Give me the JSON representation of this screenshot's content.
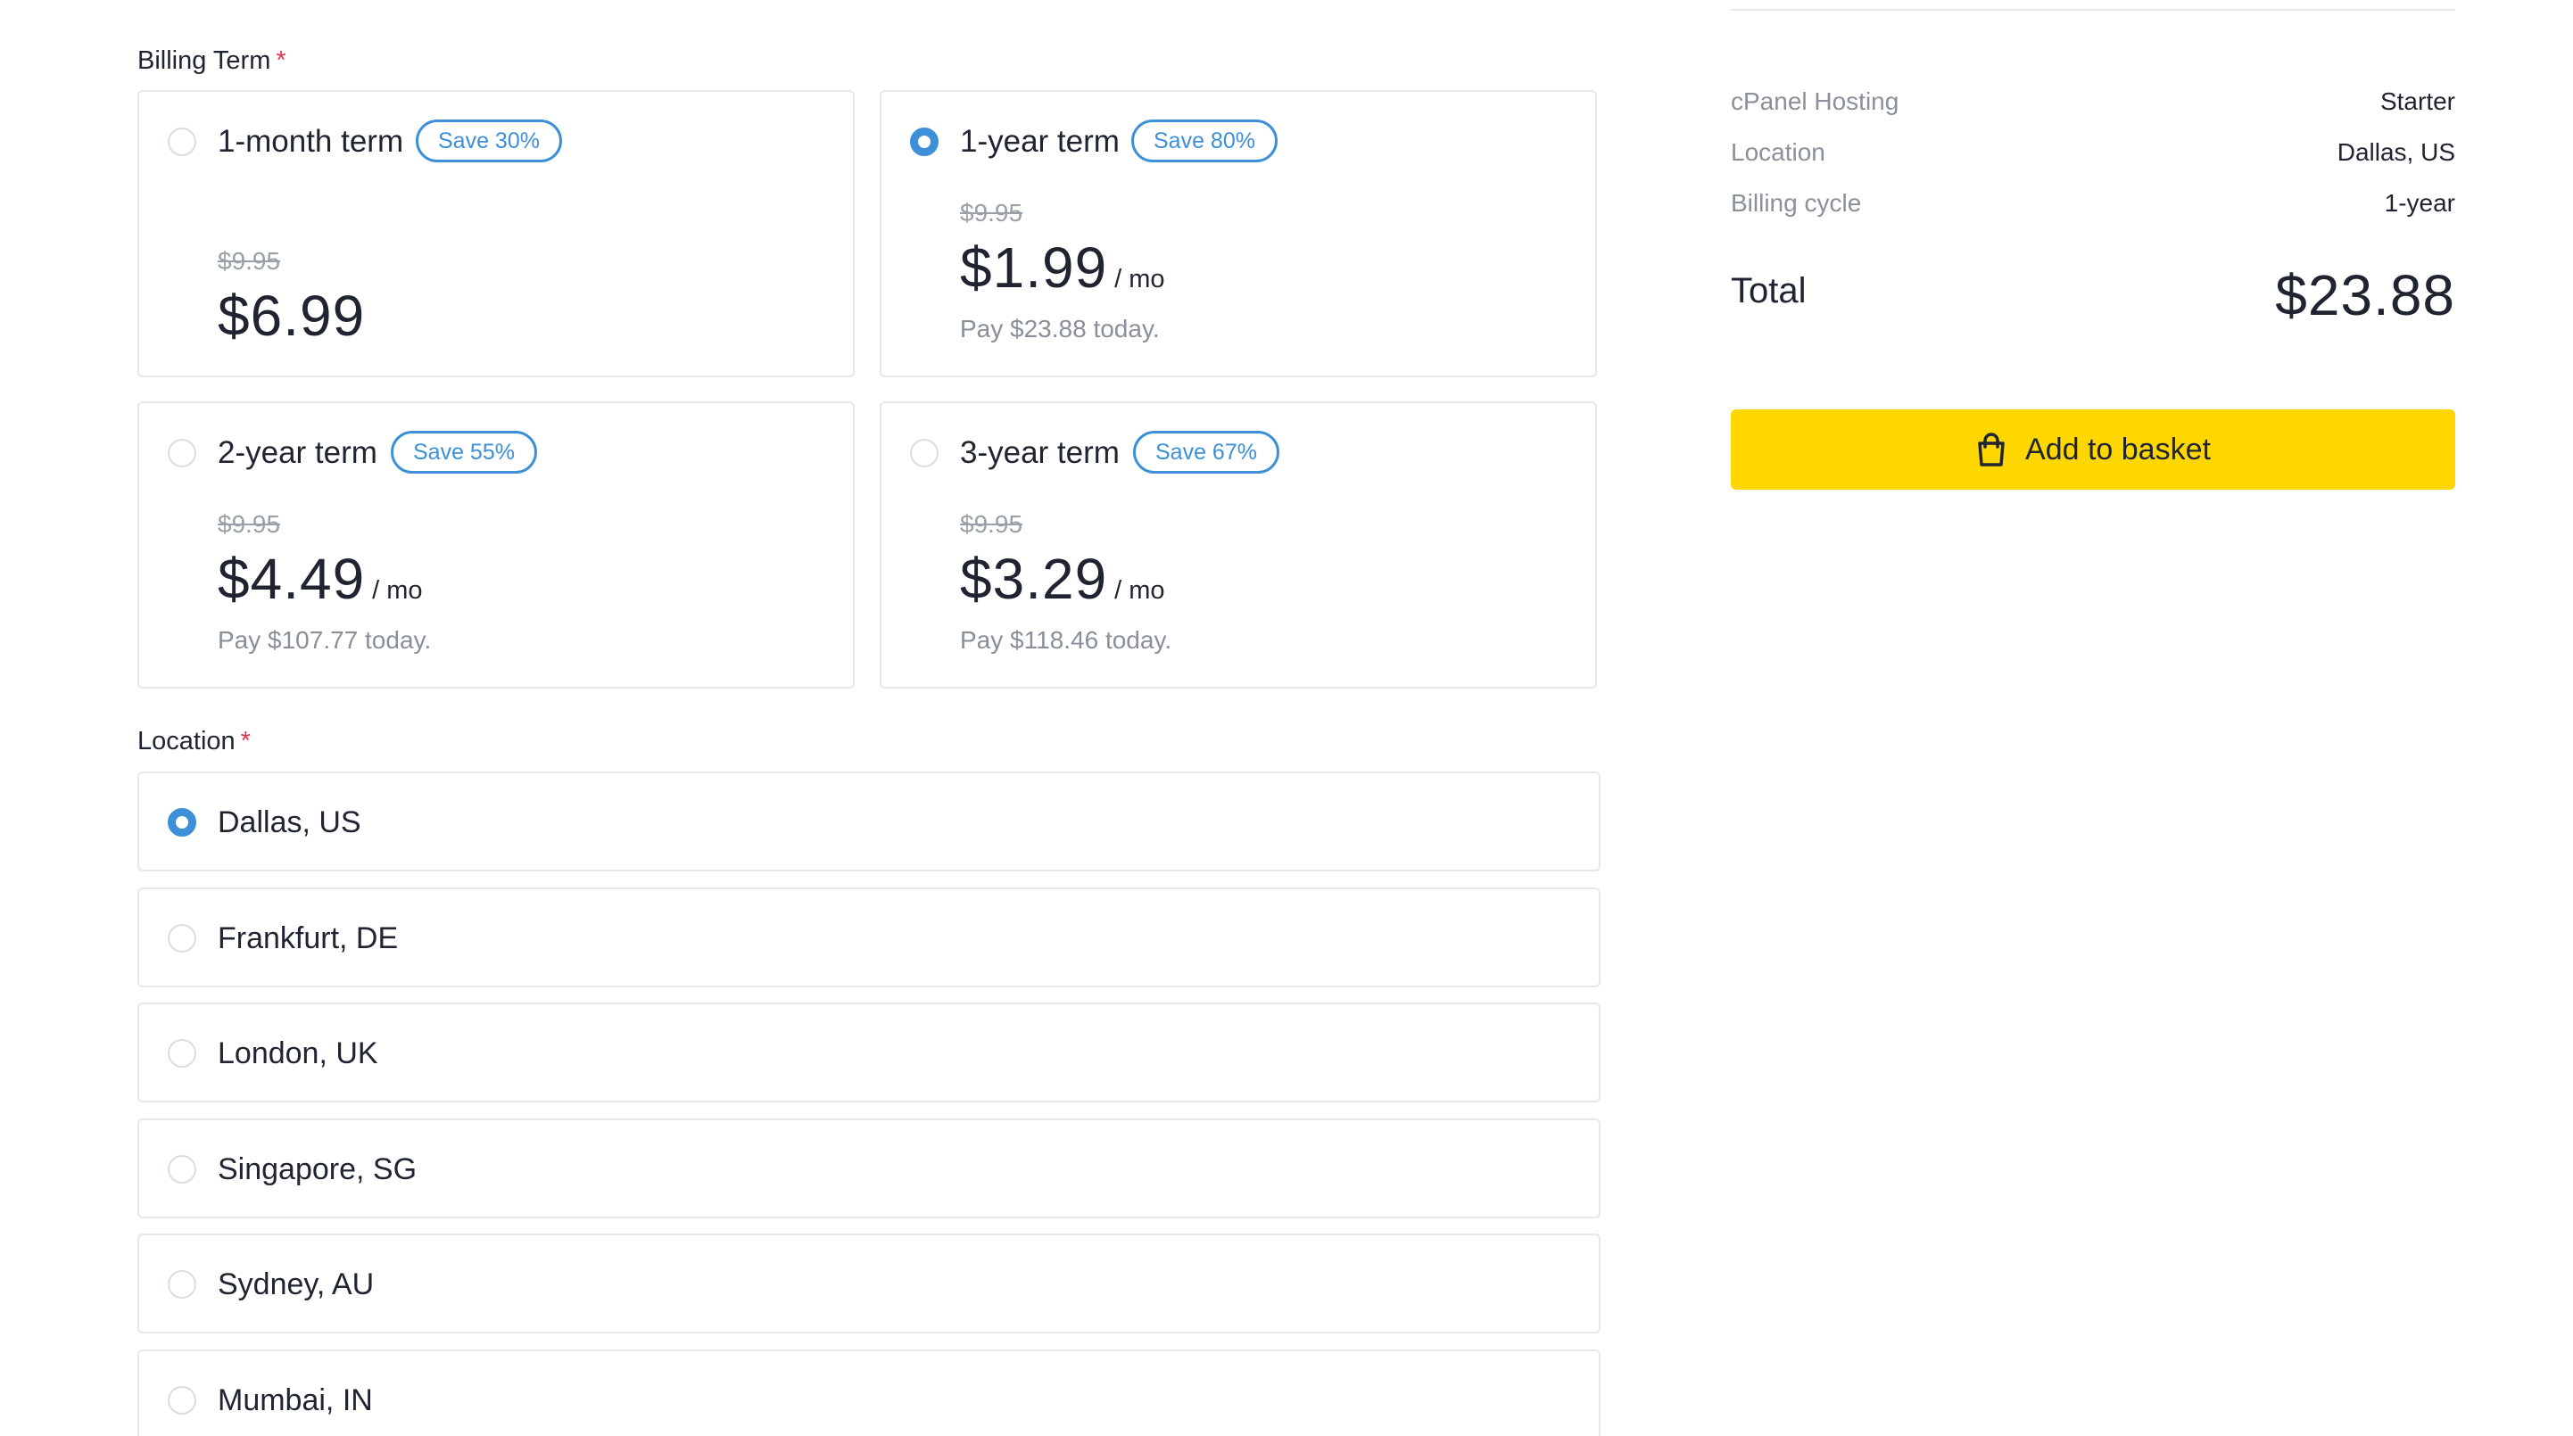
{
  "billing_term": {
    "label": "Billing Term",
    "required_mark": "*",
    "options": [
      {
        "name": "1-month term",
        "badge": "Save 30%",
        "old_price": "$9.95",
        "price": "$6.99",
        "per": "",
        "pay_today": "",
        "selected": false
      },
      {
        "name": "1-year term",
        "badge": "Save 80%",
        "old_price": "$9.95",
        "price": "$1.99",
        "per": "/ mo",
        "pay_today": "Pay $23.88 today.",
        "selected": true
      },
      {
        "name": "2-year term",
        "badge": "Save 55%",
        "old_price": "$9.95",
        "price": "$4.49",
        "per": "/ mo",
        "pay_today": "Pay $107.77 today.",
        "selected": false
      },
      {
        "name": "3-year term",
        "badge": "Save 67%",
        "old_price": "$9.95",
        "price": "$3.29",
        "per": "/ mo",
        "pay_today": "Pay $118.46 today.",
        "selected": false
      }
    ]
  },
  "location": {
    "label": "Location",
    "required_mark": "*",
    "options": [
      {
        "name": "Dallas, US",
        "selected": true
      },
      {
        "name": "Frankfurt, DE",
        "selected": false
      },
      {
        "name": "London, UK",
        "selected": false
      },
      {
        "name": "Singapore, SG",
        "selected": false
      },
      {
        "name": "Sydney, AU",
        "selected": false
      },
      {
        "name": "Mumbai, IN",
        "selected": false
      }
    ]
  },
  "summary": {
    "rows": [
      {
        "key": "cPanel Hosting",
        "value": "Starter"
      },
      {
        "key": "Location",
        "value": "Dallas, US"
      },
      {
        "key": "Billing cycle",
        "value": "1-year"
      }
    ],
    "total_label": "Total",
    "total_value": "$23.88",
    "basket_label": "Add to basket",
    "basket_icon": "shopping-bag-icon"
  },
  "colors": {
    "accent": "#3d8fd8",
    "button": "#ffd700",
    "required": "#e0364c"
  }
}
